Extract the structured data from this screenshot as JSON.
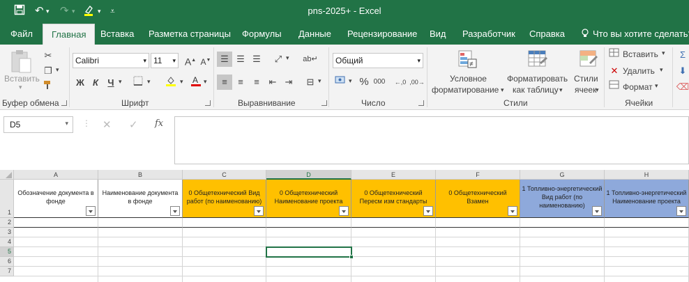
{
  "window": {
    "title": "pns-2025+  -  Excel"
  },
  "tabs": [
    "Файл",
    "Главная",
    "Вставка",
    "Разметка страницы",
    "Формулы",
    "Данные",
    "Рецензирование",
    "Вид",
    "Разработчик",
    "Справка"
  ],
  "tell_me": "Что вы хотите сделать?",
  "ribbon": {
    "clipboard": {
      "paste": "Вставить",
      "label": "Буфер обмена"
    },
    "font": {
      "name": "Calibri",
      "size": "11",
      "bold": "Ж",
      "italic": "К",
      "underline": "Ч",
      "label": "Шрифт"
    },
    "alignment": {
      "label": "Выравнивание"
    },
    "number": {
      "format": "Общий",
      "percent": "%",
      "thousands": "000",
      "label": "Число"
    },
    "styles": {
      "conditional1": "Условное",
      "conditional2": "форматирование",
      "table1": "Форматировать",
      "table2": "как таблицу",
      "cell1": "Стили",
      "cell2": "ячеек",
      "label": "Стили"
    },
    "cells": {
      "insert": "Вставить",
      "delete": "Удалить",
      "format": "Формат",
      "label": "Ячейки"
    }
  },
  "formula_bar": {
    "name_box": "D5",
    "fx": "fx",
    "value": ""
  },
  "columns": [
    "A",
    "B",
    "C",
    "D",
    "E",
    "F",
    "G",
    "H"
  ],
  "rows": [
    "1",
    "2",
    "3",
    "4",
    "5",
    "6",
    "7"
  ],
  "selected_cell": "D5",
  "colors": {
    "orange": "#FFC000",
    "blue": "#8EA9DB",
    "accent": "#217346"
  },
  "header_row": [
    {
      "text": "Обозначение документа в фонде",
      "fill": "white"
    },
    {
      "text": "Наименование документа в фонде",
      "fill": "white"
    },
    {
      "text": "0 Общетехнический Вид работ (по наименованию)",
      "fill": "orange"
    },
    {
      "text": "0 Общетехнический Наименование проекта",
      "fill": "orange"
    },
    {
      "text": "0 Общетехнический Пересм  изм  стандарты",
      "fill": "orange"
    },
    {
      "text": "0 Общетехнический Взамен",
      "fill": "orange"
    },
    {
      "text": "1 Топливно-энергетический Вид работ (по наименованию)",
      "fill": "blue"
    },
    {
      "text": "1 Топливно-энергетический Наименование проекта",
      "fill": "blue"
    }
  ]
}
